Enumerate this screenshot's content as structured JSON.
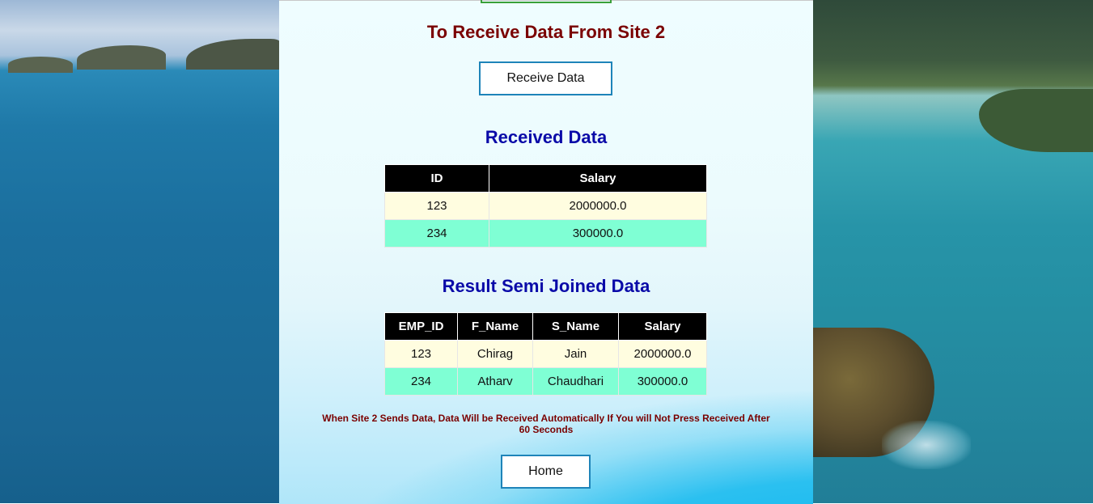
{
  "heading": "To Receive Data From Site 2",
  "receive_button": "Receive Data",
  "received": {
    "title": "Received Data",
    "columns": [
      "ID",
      "Salary"
    ],
    "rows": [
      [
        "123",
        "2000000.0"
      ],
      [
        "234",
        "300000.0"
      ]
    ]
  },
  "semi_join": {
    "title": "Result Semi Joined Data",
    "columns": [
      "EMP_ID",
      "F_Name",
      "S_Name",
      "Salary"
    ],
    "rows": [
      [
        "123",
        "Chirag",
        "Jain",
        "2000000.0"
      ],
      [
        "234",
        "Atharv",
        "Chaudhari",
        "300000.0"
      ]
    ]
  },
  "note": "When Site 2 Sends Data, Data Will be Received Automatically If You will Not Press Received After 60 Seconds",
  "home_button": "Home",
  "colors": {
    "heading": "#7a0000",
    "section_title": "#0a0aa8",
    "button_border": "#1e84b9",
    "header_bg": "#000000",
    "row_odd": "#fffde0",
    "row_even": "#7fffd4"
  }
}
